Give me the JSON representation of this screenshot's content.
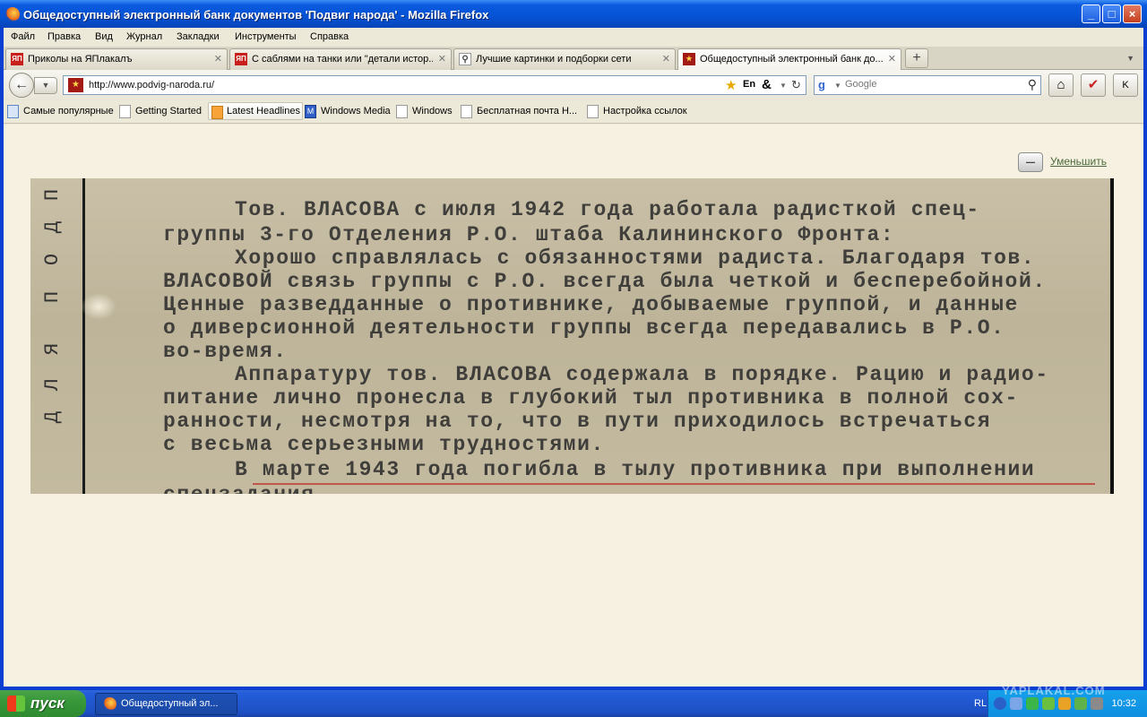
{
  "window": {
    "title": "Общедоступный электронный банк документов 'Подвиг народа' - Mozilla Firefox"
  },
  "menu": [
    "Файл",
    "Правка",
    "Вид",
    "Журнал",
    "Закладки",
    "Инструменты",
    "Справка"
  ],
  "tabs": [
    {
      "label": "Приколы на ЯПлакалъ",
      "favicon": "ЯП"
    },
    {
      "label": "С саблями на танки или \"детали истор...",
      "favicon": "ЯП"
    },
    {
      "label": "Лучшие картинки и подборки сети",
      "favicon": "magnifier-icon"
    },
    {
      "label": "Общедоступный электронный банк до...",
      "favicon": "star-icon"
    }
  ],
  "nav": {
    "url": "http://www.podvig-naroda.ru/",
    "en_label": "En",
    "search_placeholder": "Google"
  },
  "bookmarks": [
    "Самые популярные",
    "Getting Started",
    "Latest Headlines",
    "Windows Media",
    "Windows",
    "Бесплатная почта Н...",
    "Настройка ссылок"
  ],
  "page": {
    "shrink_label": "Уменьшить",
    "doc_side_text": [
      "Д",
      "Л",
      "Я",
      "П",
      "О",
      "Д",
      "П"
    ],
    "doc_lines": [
      "Тов. ВЛАСОВА с июля 1942 года работала радисткой спец-",
      "группы 3-го Отделения Р.О. штаба Калининского Фронта:",
      "Хорошо справлялась с обязанностями радиста. Благодаря тов.",
      "ВЛАСОВОЙ связь группы с Р.О. всегда была четкой и бесперебойной.",
      "Ценные разведданные о противнике, добываемые группой, и данные",
      "о диверсионной деятельности группы всегда передавались в Р.О.",
      "во-время.",
      "Аппаратуру тов. ВЛАСОВА содержала в порядке. Рацию и радио-",
      "питание лично пронесла в глубокий тыл противника в полной сох-",
      "ранности, несмотря на то, что в пути приходилось встречаться",
      "с весьма серьезными трудностями.",
      "В марте 1943 года погибла в тылу противника при выполнении",
      "спецзадания."
    ]
  },
  "taskbar": {
    "start_label": "пуск",
    "task_label": "Общедоступный эл...",
    "lang": "RL",
    "time": "10:32"
  },
  "watermark": "YAPLAKAL.COM",
  "colors": {
    "title_blue": "#0553d4",
    "page_bg": "#f6f1e1",
    "doc_bg": "#c3ba9f",
    "underline_red": "#c0443a"
  }
}
